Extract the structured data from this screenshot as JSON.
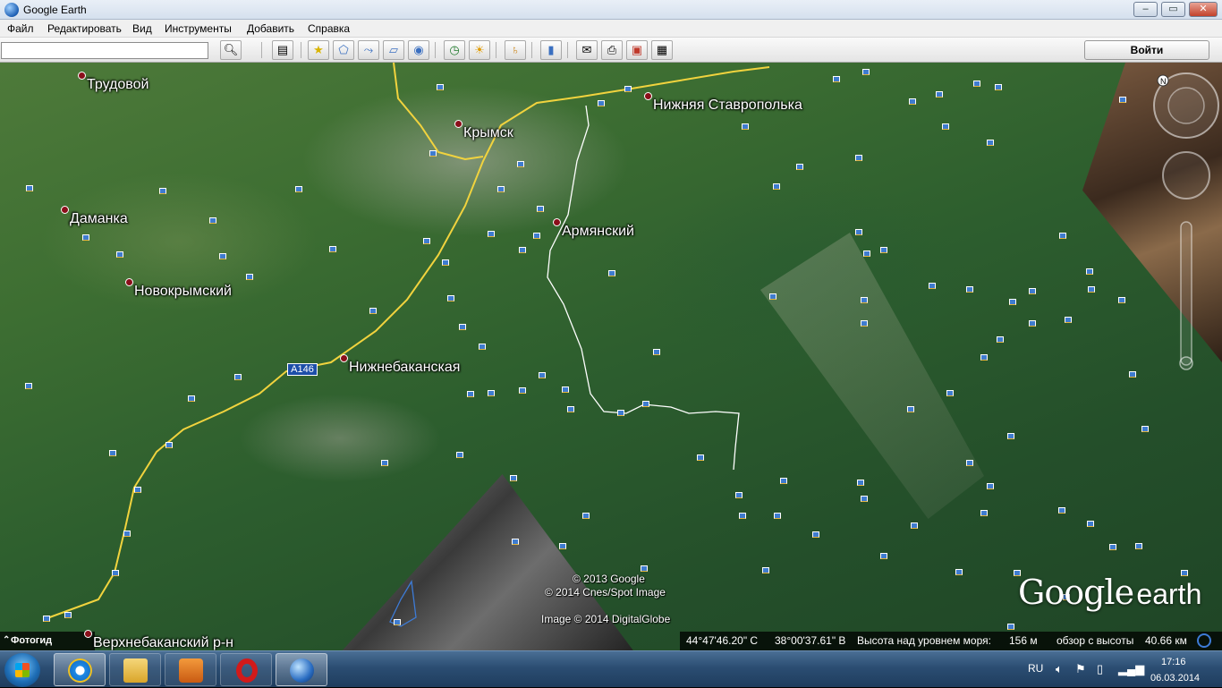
{
  "window": {
    "title": "Google Earth",
    "btn_min": "–",
    "btn_max": "▭",
    "btn_close": "✕"
  },
  "menu": [
    "Файл",
    "Редактировать",
    "Вид",
    "Инструменты",
    "Добавить",
    "Справка"
  ],
  "toolbar": {
    "search_value": "",
    "search_placeholder": "",
    "login_label": "Войти",
    "icons": [
      "search-icon",
      "sidebar-toggle-icon",
      "placemark-icon",
      "polygon-icon",
      "path-icon",
      "image-overlay-icon",
      "record-tour-icon",
      "historical-imagery-icon",
      "sunlight-icon",
      "planets-icon",
      "ruler-icon",
      "email-icon",
      "print-icon",
      "view-in-maps-icon",
      "save-image-icon"
    ]
  },
  "map": {
    "places": [
      {
        "name": "Трудовой"
      },
      {
        "name": "Крымск"
      },
      {
        "name": "Нижняя Ставрополька"
      },
      {
        "name": "Даманка"
      },
      {
        "name": "Армянский"
      },
      {
        "name": "Новокрымский"
      },
      {
        "name": "Нижнебаканская"
      },
      {
        "name": "Верхнебаканский р-н"
      }
    ],
    "road_shield": "A146",
    "copyright": [
      "© 2013 Google",
      "© 2014 Cnes/Spot Image",
      "Image © 2014 DigitalGlobe"
    ],
    "photo_guide": "Фотогид",
    "logo_google": "Google",
    "logo_earth": "earth"
  },
  "status": {
    "lat": "44°47'46.20\" С",
    "lon": "38°00'37.61\" В",
    "elev_label": "Высота над уровнем моря:",
    "elev_value": "156 м",
    "eye_label": "обзор с высоты",
    "eye_value": "40.66 км"
  },
  "taskbar": {
    "apps": [
      "start-button",
      "internet-explorer-icon",
      "file-explorer-icon",
      "media-player-icon",
      "opera-icon",
      "google-earth-icon"
    ],
    "lang": "RU",
    "time": "17:16",
    "date": "06.03.2014"
  },
  "colors": {
    "road": "#f1d33e",
    "place_dot": "#8a0f1a",
    "pin": "#3f7ccf",
    "taskbar": "#2b4d72"
  }
}
